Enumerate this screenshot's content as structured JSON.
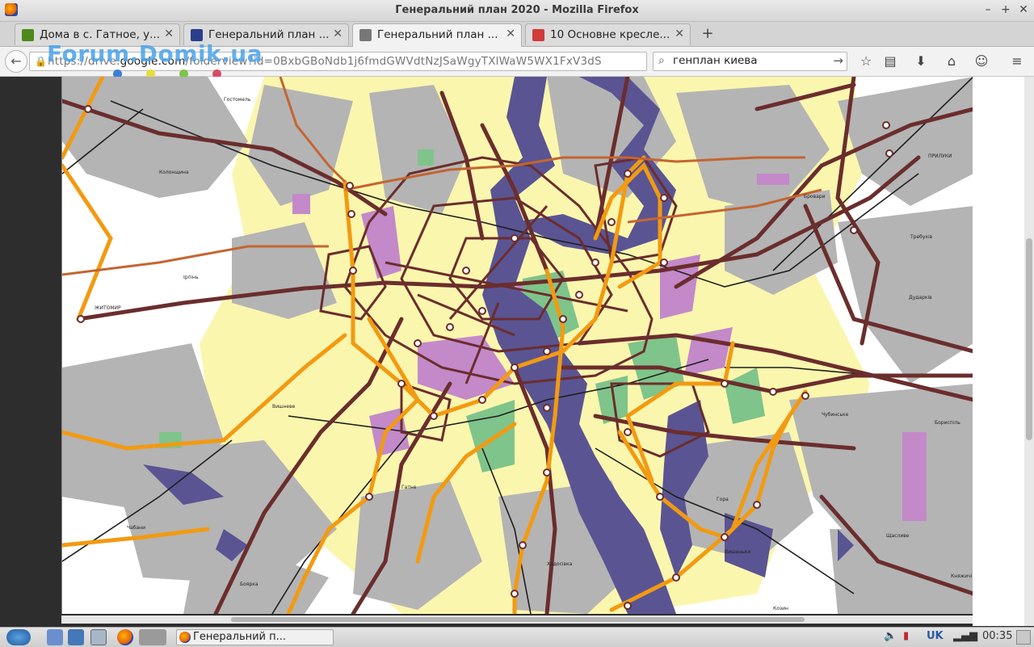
{
  "window": {
    "title": "Генеральний план 2020 - Mozilla Firefox"
  },
  "tabs": [
    {
      "label": "Дома в с. Гатное, у...",
      "icon": "forum-tab-icon",
      "color": "#4d8a1a",
      "active": false
    },
    {
      "label": "Генеральний план ...",
      "icon": "gov-tab-icon",
      "color": "#2a3f8e",
      "active": false
    },
    {
      "label": "Генеральний план ...",
      "icon": "drive-tab-icon",
      "color": "#777777",
      "active": true
    },
    {
      "label": "10 Основне кресле...",
      "icon": "red-tab-icon",
      "color": "#d03b3b",
      "active": false
    }
  ],
  "nav": {
    "url_prefix": "https://drive.",
    "url_host": "google.com",
    "url_rest": "/folderview?id=0BxbGBoNdb1j6fmdGWVdtNzJSaWgyTXlWaW5WX1FxV3dS",
    "search_value": "генплан киева"
  },
  "watermark": {
    "text": "Forum.Domik.ua",
    "dots": [
      "#3b7fd6",
      "#e8de3a",
      "#7ec44a",
      "#d84a6a"
    ]
  },
  "map": {
    "labels": [
      "ЖИТОМИР",
      "ПРИЛУКИ",
      "Бровари",
      "Бориспіль",
      "Гора",
      "Вишеньки",
      "Дударків",
      "Чубинське",
      "Щасливе",
      "Требухів",
      "Княжичі",
      "Гатне",
      "Ходосівка",
      "Козин",
      "Гостомель",
      "Ірпінь",
      "Боярка",
      "Вишневе",
      "Чабани",
      "Колонщина"
    ],
    "colors": {
      "river": "#5a5493",
      "trunk": "#6b2d2d",
      "ring": "#f29a11",
      "green": "#7fc48a",
      "purple": "#c389c9",
      "yellow": "#fbf6ae",
      "gray": "#b4b4b4"
    }
  },
  "taskbar": {
    "task_label": "Генеральний п...",
    "lang": "UK",
    "time": "00:35"
  }
}
